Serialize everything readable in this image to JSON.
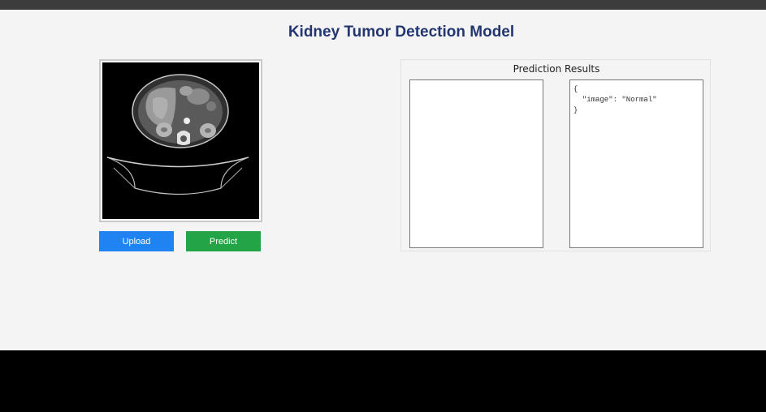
{
  "app": {
    "title": "Kidney Tumor Detection Model"
  },
  "image_panel": {
    "image_description": "axial CT scan of abdomen",
    "upload_label": "Upload",
    "predict_label": "Predict"
  },
  "results": {
    "title": "Prediction Results",
    "left_box_text": "",
    "json_output": "{\n  \"image\": \"Normal\"\n}"
  },
  "colors": {
    "title": "#23366f",
    "upload_button": "#1f84f2",
    "predict_button": "#22a447",
    "background": "#f4f4f5"
  }
}
